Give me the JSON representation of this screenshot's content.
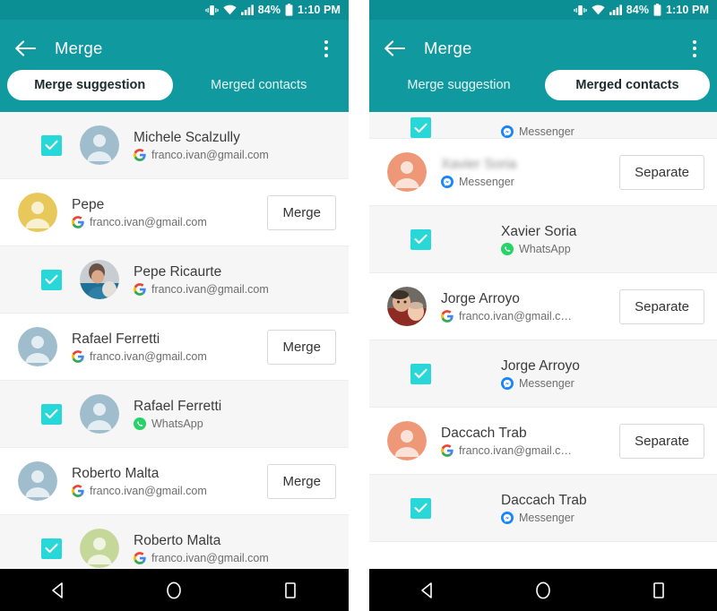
{
  "status_bar": {
    "vibrate_icon": "vibrate-icon",
    "wifi_icon": "wifi-icon",
    "signal_icon": "signal-bars-icon",
    "battery_percent": "84%",
    "battery_icon": "battery-icon",
    "time": "1:10 PM"
  },
  "colors": {
    "appbar_teal": "#10999f",
    "statusbar_teal": "#0b8e94",
    "checkbox_cyan": "#28d7d7",
    "avatar_gray_blue": "#9fbdcd",
    "avatar_yellow": "#e8c85a",
    "avatar_green": "#c5d89a",
    "avatar_orange": "#ee9878",
    "row_child_bg": "#f6f6f6"
  },
  "left_screen": {
    "appbar": {
      "back_icon": "back-arrow-icon",
      "title": "Merge",
      "overflow_icon": "overflow-menu-icon"
    },
    "tabs": [
      {
        "label": "Merge suggestion",
        "active": true
      },
      {
        "label": "Merged contacts",
        "active": false
      }
    ],
    "rows": [
      {
        "type": "child",
        "checked": true,
        "avatar": "gray_blue",
        "avatar_photo": false,
        "name": "Michele Scalzully",
        "name_blurred": false,
        "sub_icon": "google-icon",
        "sub_text": "franco.ivan@gmail.com",
        "action": null
      },
      {
        "type": "parent",
        "checked": false,
        "avatar": "yellow",
        "avatar_photo": false,
        "name": "Pepe",
        "name_blurred": false,
        "sub_icon": "google-icon",
        "sub_text": "franco.ivan@gmail.com",
        "action": "Merge"
      },
      {
        "type": "child",
        "checked": true,
        "avatar": "photo_pepe",
        "avatar_photo": true,
        "name": "Pepe Ricaurte",
        "name_blurred": false,
        "sub_icon": "google-icon",
        "sub_text": "franco.ivan@gmail.com",
        "action": null
      },
      {
        "type": "parent",
        "checked": false,
        "avatar": "gray_blue",
        "avatar_photo": false,
        "name": "Rafael Ferretti",
        "name_blurred": false,
        "sub_icon": "google-icon",
        "sub_text": "franco.ivan@gmail.com",
        "action": "Merge"
      },
      {
        "type": "child",
        "checked": true,
        "avatar": "gray_blue",
        "avatar_photo": false,
        "name": "Rafael Ferretti",
        "name_blurred": false,
        "sub_icon": "whatsapp-icon",
        "sub_text": "WhatsApp",
        "action": null
      },
      {
        "type": "parent",
        "checked": false,
        "avatar": "gray_blue",
        "avatar_photo": false,
        "name": "Roberto Malta",
        "name_blurred": false,
        "sub_icon": "google-icon",
        "sub_text": "franco.ivan@gmail.com",
        "action": "Merge"
      },
      {
        "type": "child",
        "checked": true,
        "avatar": "green",
        "avatar_photo": false,
        "name": "Roberto Malta",
        "name_blurred": false,
        "sub_icon": "google-icon",
        "sub_text": "franco.ivan@gmail.com",
        "action": null
      }
    ]
  },
  "right_screen": {
    "appbar": {
      "back_icon": "back-arrow-icon",
      "title": "Merge",
      "overflow_icon": "overflow-menu-icon"
    },
    "tabs": [
      {
        "label": "Merge suggestion",
        "active": false
      },
      {
        "label": "Merged contacts",
        "active": true
      }
    ],
    "rows": [
      {
        "type": "partial",
        "checked": true,
        "avatar": null,
        "avatar_photo": false,
        "name": "",
        "name_blurred": false,
        "sub_icon": "messenger-icon",
        "sub_text": "Messenger",
        "action": null
      },
      {
        "type": "parent",
        "checked": false,
        "avatar": "orange",
        "avatar_photo": false,
        "name": "Xavier Soria",
        "name_blurred": true,
        "sub_icon": "messenger-icon",
        "sub_text": "Messenger",
        "action": "Separate"
      },
      {
        "type": "child",
        "checked": true,
        "avatar": null,
        "avatar_photo": false,
        "name": "Xavier Soria",
        "name_blurred": false,
        "sub_icon": "whatsapp-icon",
        "sub_text": "WhatsApp",
        "action": null
      },
      {
        "type": "parent",
        "checked": false,
        "avatar": "photo_jorge",
        "avatar_photo": true,
        "name": "Jorge Arroyo",
        "name_blurred": false,
        "sub_icon": "google-icon",
        "sub_text": "franco.ivan@gmail.c…",
        "action": "Separate"
      },
      {
        "type": "child",
        "checked": true,
        "avatar": null,
        "avatar_photo": false,
        "name": "Jorge Arroyo",
        "name_blurred": false,
        "sub_icon": "messenger-icon",
        "sub_text": "Messenger",
        "action": null
      },
      {
        "type": "parent",
        "checked": false,
        "avatar": "orange",
        "avatar_photo": false,
        "name": "Daccach Trab",
        "name_blurred": false,
        "sub_icon": "google-icon",
        "sub_text": "franco.ivan@gmail.c…",
        "action": "Separate"
      },
      {
        "type": "child",
        "checked": true,
        "avatar": null,
        "avatar_photo": false,
        "name": "Daccach Trab",
        "name_blurred": false,
        "sub_icon": "messenger-icon",
        "sub_text": "Messenger",
        "action": null
      }
    ]
  },
  "nav_bar": {
    "back_icon": "nav-back-triangle-icon",
    "home_icon": "nav-home-circle-icon",
    "recents_icon": "nav-recents-square-icon"
  }
}
